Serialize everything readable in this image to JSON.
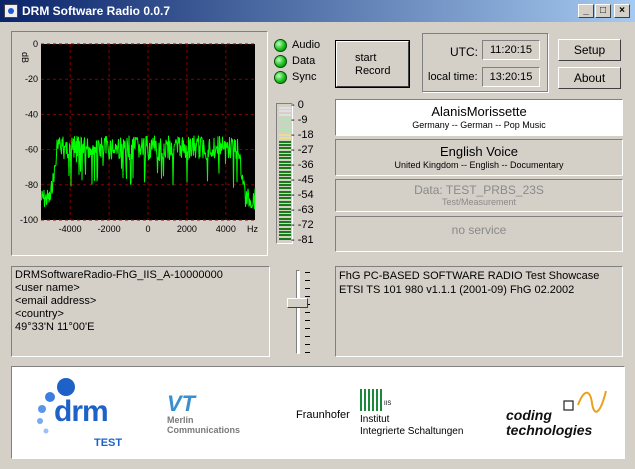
{
  "window": {
    "title": "DRM Software Radio 0.0.7",
    "minimize": "_",
    "maximize": "□",
    "close": "×"
  },
  "spectrum": {
    "y_labels": [
      "0",
      "-20",
      "-40",
      "-60",
      "-80",
      "-100"
    ],
    "y_unit": "dB",
    "x_labels": [
      "-4000",
      "-2000",
      "0",
      "2000",
      "4000"
    ],
    "x_unit": "Hz",
    "trace_color": "#00ff00"
  },
  "status": {
    "audio": "Audio",
    "data": "Data",
    "sync": "Sync"
  },
  "record_button": {
    "line1": "start",
    "line2": "Record"
  },
  "time": {
    "utc_label": "UTC:",
    "utc_value": "11:20:15",
    "local_label": "local time:",
    "local_value": "13:20:15"
  },
  "buttons": {
    "setup": "Setup",
    "about": "About"
  },
  "meter": {
    "labels": [
      "0",
      "-9",
      "-18",
      "-27",
      "-36",
      "-45",
      "-54",
      "-63",
      "-72",
      "-81"
    ]
  },
  "stations": [
    {
      "name": "AlanisMorissette",
      "info": "Germany  --  German  --  Pop Music"
    },
    {
      "name": "English Voice",
      "info": "United Kingdom  --  English  --  Documentary"
    },
    {
      "name": "Data: TEST_PRBS_23S",
      "info": "Test/Measurement"
    },
    {
      "name": "no service",
      "info": ""
    }
  ],
  "station_id": {
    "lines": [
      "DRMSoftwareRadio-FhG_IIS_A-10000000",
      "<user name>",
      "<email address>",
      "<country>",
      "49°33'N  11°00'E"
    ]
  },
  "about_text": {
    "lines": [
      "FhG PC-BASED  SOFTWARE RADIO    Test Showcase",
      "ETSI TS 101 980  v1.1.1 (2001-09)    FhG 02.2002"
    ]
  },
  "logos": {
    "drm": {
      "text": "drm",
      "sub": "TEST"
    },
    "merlin": {
      "mark": "VT",
      "line1": "Merlin",
      "line2": "Communications"
    },
    "fraunhofer": {
      "name": "Fraunhofer",
      "inst1": "Institut",
      "inst2": "Integrierte Schaltungen",
      "badge": "IIS"
    },
    "coding": {
      "line1": "coding",
      "line2": "technologies"
    }
  }
}
